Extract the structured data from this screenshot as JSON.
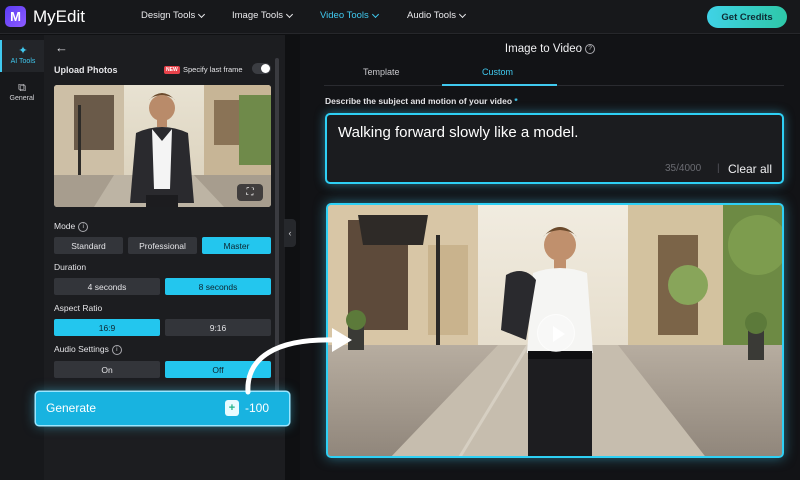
{
  "app": {
    "name": "MyEdit",
    "logo_letter": "M"
  },
  "nav": [
    {
      "label": "Design Tools",
      "active": false
    },
    {
      "label": "Image Tools",
      "active": false
    },
    {
      "label": "Video Tools",
      "active": true
    },
    {
      "label": "Audio Tools",
      "active": false
    }
  ],
  "header": {
    "cta_label": "Get Credits"
  },
  "rail": [
    {
      "label": "AI Tools",
      "icon": "magic-wand-icon",
      "active": true
    },
    {
      "label": "General",
      "icon": "copy-icon",
      "active": false
    }
  ],
  "panel": {
    "upload_label": "Upload Photos",
    "new_badge": "NEW",
    "specify_last_frame_label": "Specify last frame",
    "specify_last_frame_on": false,
    "mode": {
      "label": "Mode",
      "options": [
        "Standard",
        "Professional",
        "Master"
      ],
      "selected": "Master"
    },
    "duration": {
      "label": "Duration",
      "options": [
        "4 seconds",
        "8 seconds"
      ],
      "selected": "8 seconds"
    },
    "aspect": {
      "label": "Aspect Ratio",
      "options": [
        "16:9",
        "9:16"
      ],
      "selected": "16:9"
    },
    "audio": {
      "label": "Audio Settings",
      "options": [
        "On",
        "Off"
      ],
      "selected": "Off"
    },
    "generate": {
      "label": "Generate",
      "cost": "-100"
    }
  },
  "main": {
    "title": "Image to Video",
    "tabs": [
      {
        "label": "Template",
        "active": false
      },
      {
        "label": "Custom",
        "active": true
      }
    ],
    "prompt_label": "Describe the subject and motion of your video",
    "required_mark": "*",
    "prompt_text": "Walking forward slowly like a model.",
    "char_count": "35/4000",
    "separator": "|",
    "clear_label": "Clear all"
  },
  "colors": {
    "accent": "#40c9ef",
    "background": "#0f1012",
    "panel": "#1c1d20"
  }
}
